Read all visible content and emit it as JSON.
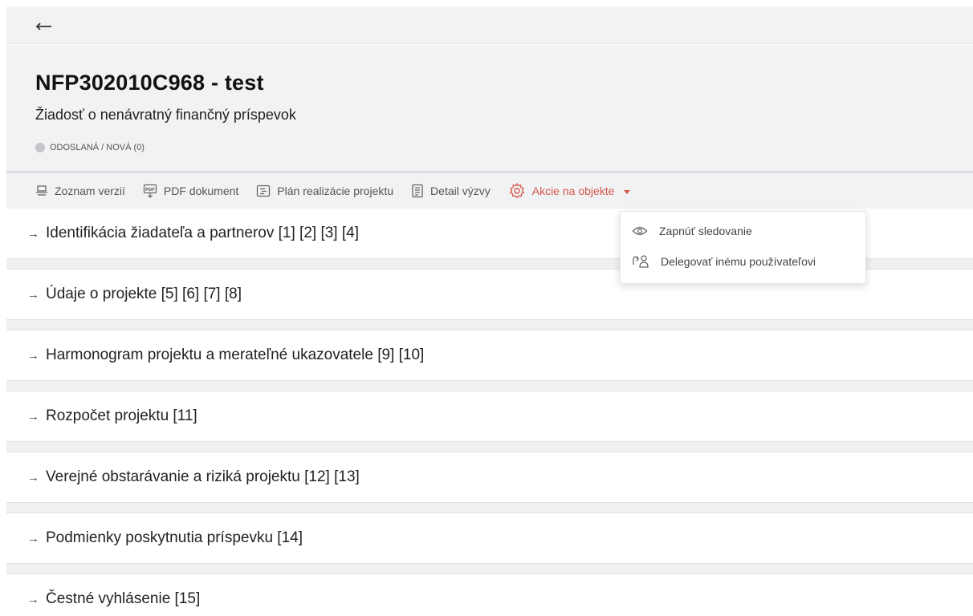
{
  "nav": {
    "back_icon": "arrow-left-icon"
  },
  "header": {
    "title": "NFP302010C968 - test",
    "subtitle": "Žiadosť o nenávratný finančný príspevok",
    "status": "ODOSLANÁ / NOVÁ (0)",
    "status_color": "#c4c6c9"
  },
  "toolbar": {
    "items": [
      {
        "label": "Zoznam verzií",
        "icon": "versions-icon"
      },
      {
        "label": "PDF dokument",
        "icon": "pdf-icon"
      },
      {
        "label": "Plán realizácie projektu",
        "icon": "plan-icon"
      },
      {
        "label": "Detail výzvy",
        "icon": "document-icon"
      },
      {
        "label": "Akcie na objekte",
        "icon": "gear-icon"
      }
    ],
    "accent_color": "#d4574a"
  },
  "dropdown": {
    "items": [
      {
        "label": "Zapnúť sledovanie",
        "icon": "eye-icon"
      },
      {
        "label": "Delegovať inému používateľovi",
        "icon": "delegate-user-icon"
      }
    ]
  },
  "sections": [
    {
      "label": "Identifikácia žiadateľa a partnerov [1] [2] [3] [4]"
    },
    {
      "label": "Údaje o projekte [5] [6] [7] [8]"
    },
    {
      "label": "Harmonogram projektu a merateľné ukazovatele [9] [10]"
    },
    {
      "label": "Rozpočet projektu [11]"
    },
    {
      "label": "Verejné obstarávanie a riziká projektu [12] [13]"
    },
    {
      "label": "Podmienky poskytnutia príspevku [14]"
    },
    {
      "label": "Čestné vyhlásenie [15]"
    }
  ],
  "section_arrow": "→"
}
